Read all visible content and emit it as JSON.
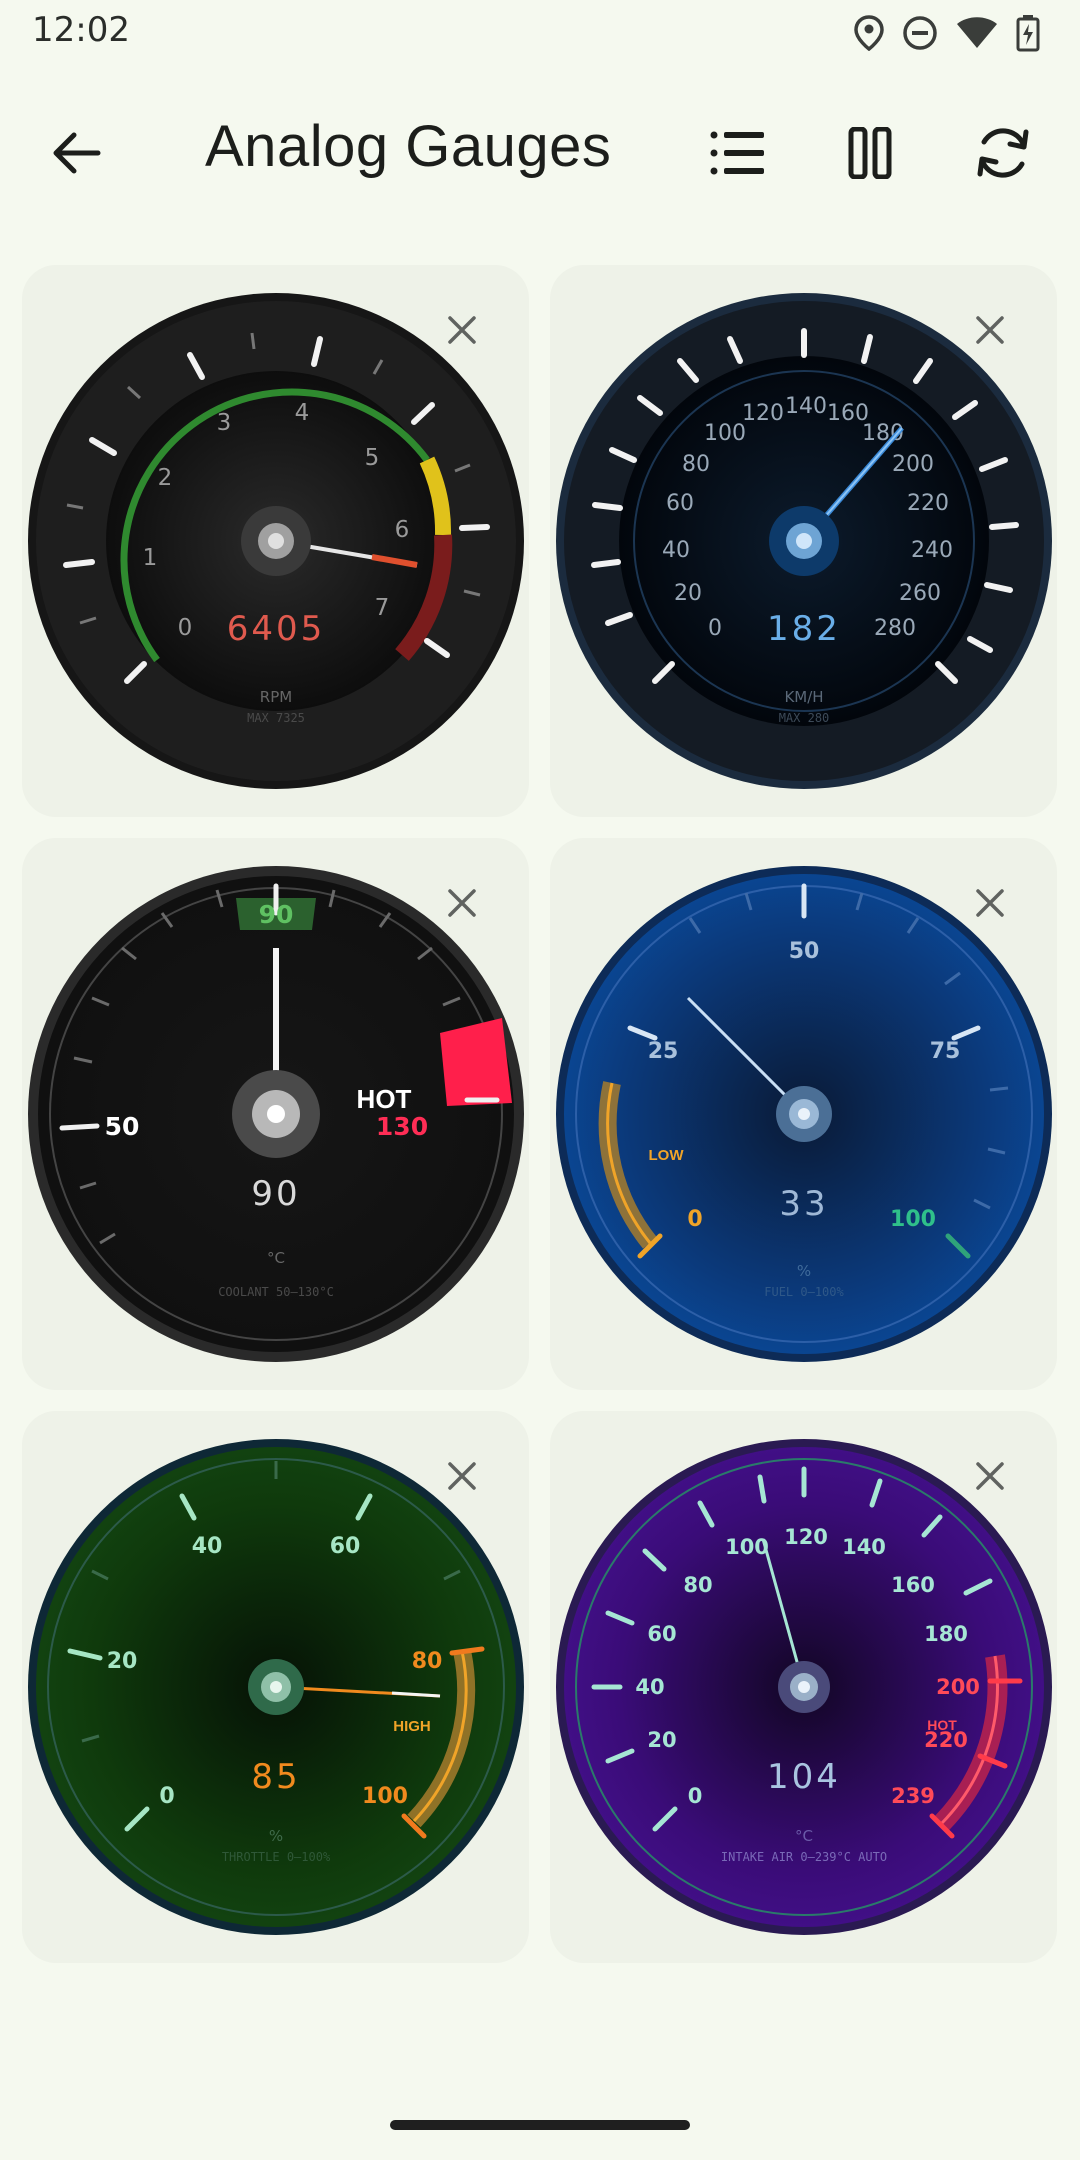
{
  "status_bar": {
    "time": "12:02",
    "icons": [
      "location-icon",
      "do-not-disturb-icon",
      "wifi-icon",
      "battery-charging-icon"
    ]
  },
  "app_bar": {
    "title": "Analog Gauges",
    "back_icon": "arrow-back-icon",
    "actions": [
      "list-icon",
      "pause-icon",
      "refresh-icon"
    ]
  },
  "gauges": [
    {
      "name": "rpm",
      "value": "6405",
      "unit": "RPM",
      "subtitle": "MAX 7325",
      "ticks": [
        "0",
        "1",
        "2",
        "3",
        "4",
        "5",
        "6",
        "7"
      ],
      "value_color": "#e05a4e",
      "accent": "#3c9a3a"
    },
    {
      "name": "speed",
      "value": "182",
      "unit": "KM/H",
      "subtitle": "MAX 280",
      "ticks": [
        "0",
        "20",
        "40",
        "60",
        "80",
        "100",
        "120",
        "140",
        "160",
        "180",
        "200",
        "220",
        "240",
        "260",
        "280"
      ],
      "value_color": "#6aaee8",
      "accent": "#3b8ad8"
    },
    {
      "name": "coolant",
      "value": "90",
      "unit": "°C",
      "subtitle": "COOLANT 50–130°C",
      "ticks": [
        "50",
        "90",
        "130"
      ],
      "warn_label": "HOT",
      "value_color": "#d9d9d9",
      "accent": "#ff1f4b"
    },
    {
      "name": "fuel",
      "value": "33",
      "unit": "%",
      "subtitle": "FUEL 0–100%",
      "ticks": [
        "0",
        "25",
        "50",
        "75",
        "100"
      ],
      "warn_label": "LOW",
      "value_color": "#9fb8d6",
      "accent": "#f0a428"
    },
    {
      "name": "throttle",
      "value": "85",
      "unit": "%",
      "subtitle": "THROTTLE 0–100%",
      "ticks": [
        "0",
        "20",
        "40",
        "60",
        "80",
        "100"
      ],
      "warn_label": "HIGH",
      "value_color": "#f08a1e",
      "accent": "#f0a428"
    },
    {
      "name": "intake-air",
      "value": "104",
      "unit": "°C",
      "subtitle": "INTAKE AIR 0–239°C AUTO",
      "ticks": [
        "0",
        "20",
        "40",
        "60",
        "80",
        "100",
        "120",
        "140",
        "160",
        "180",
        "200",
        "220",
        "239"
      ],
      "warn_label": "HOT",
      "value_color": "#a9c4e0",
      "accent": "#ff3b4a"
    }
  ],
  "close_icon": "close-icon"
}
